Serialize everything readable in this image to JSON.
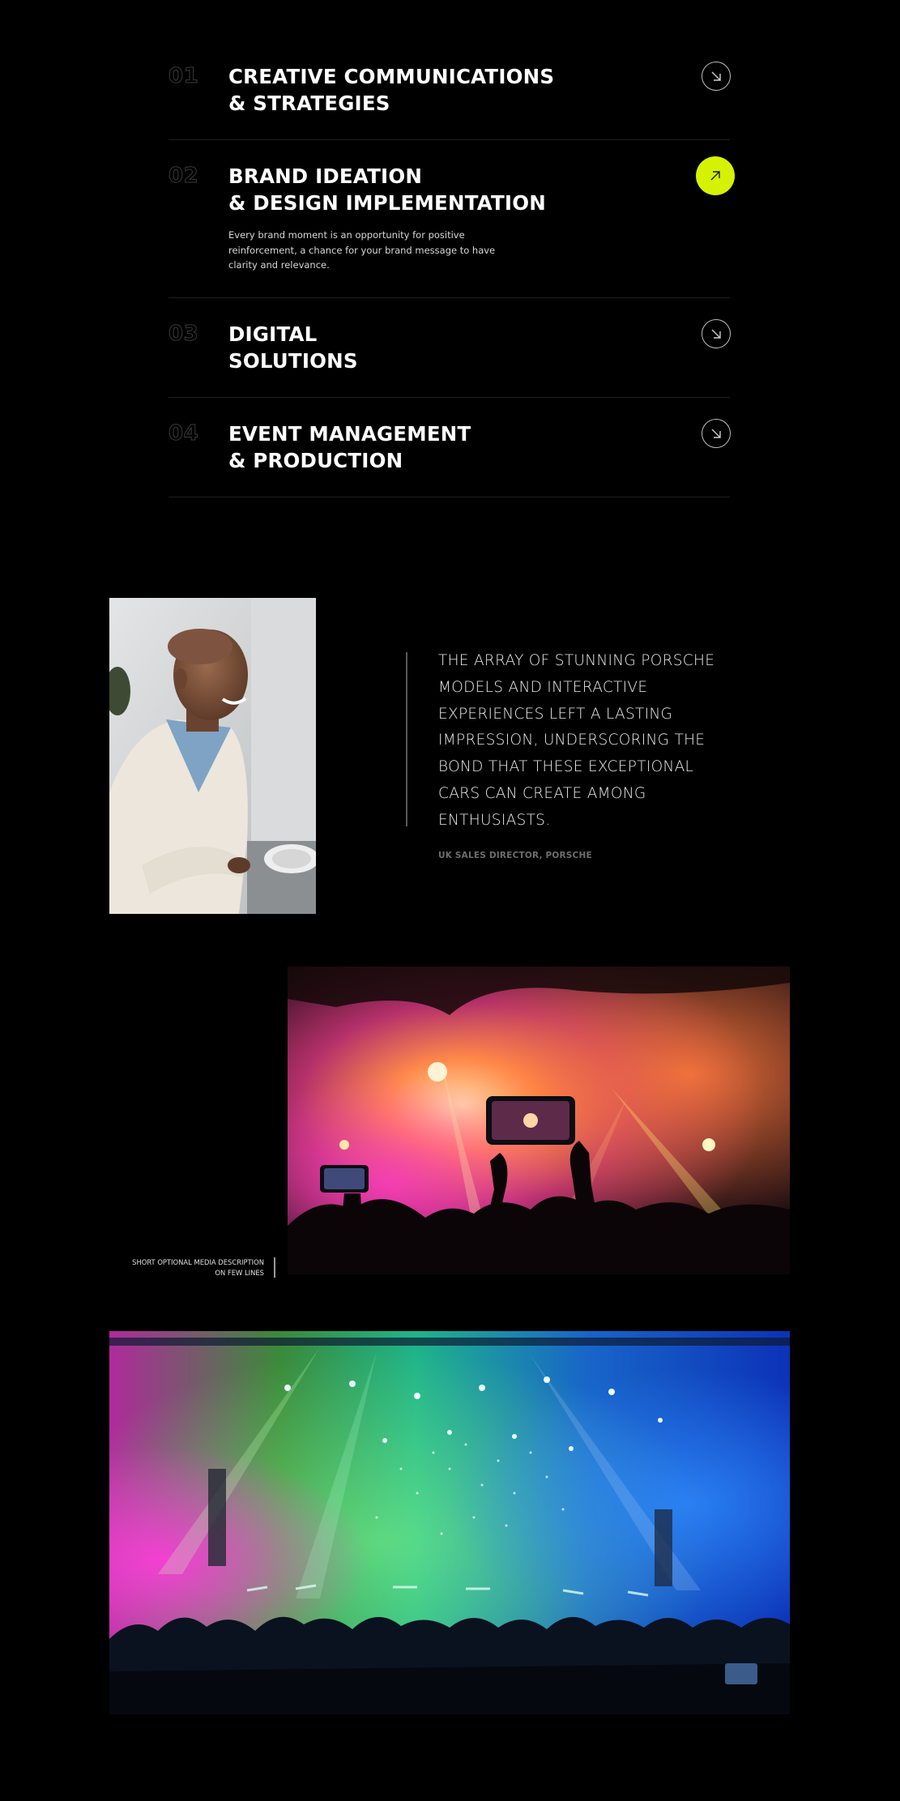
{
  "services": [
    {
      "number": "01",
      "title_line1": "CREATIVE COMMUNICATIONS",
      "title_line2": "& STRATEGIES",
      "description": "",
      "expanded": false
    },
    {
      "number": "02",
      "title_line1": "BRAND IDEATION",
      "title_line2": "& DESIGN IMPLEMENTATION",
      "description": "Every brand moment is an opportunity for positive reinforcement, a chance for your brand message to have clarity and relevance.",
      "expanded": true
    },
    {
      "number": "03",
      "title_line1": "DIGITAL",
      "title_line2": "SOLUTIONS",
      "description": "",
      "expanded": false
    },
    {
      "number": "04",
      "title_line1": "EVENT MANAGEMENT",
      "title_line2": "& PRODUCTION",
      "description": "",
      "expanded": false
    }
  ],
  "testimonial": {
    "quote": "THE ARRAY OF STUNNING PORSCHE MODELS AND INTERACTIVE EXPERIENCES LEFT A LASTING IMPRESSION, UNDERSCORING THE BOND THAT THESE EXCEPTIONAL CARS CAN CREATE AMONG ENTHUSIASTS.",
    "author": "UK SALES DIRECTOR, PORSCHE"
  },
  "media": {
    "caption_line1": "SHORT OPTIONAL MEDIA DESCRIPTION",
    "caption_line2": "ON FEW LINES"
  },
  "icons": {
    "collapsed": "arrow-down-right-icon",
    "active": "arrow-up-right-icon"
  },
  "colors": {
    "background": "#000000",
    "accent": "#d5f205",
    "text": "#ffffff",
    "muted": "#6d6d6d"
  }
}
